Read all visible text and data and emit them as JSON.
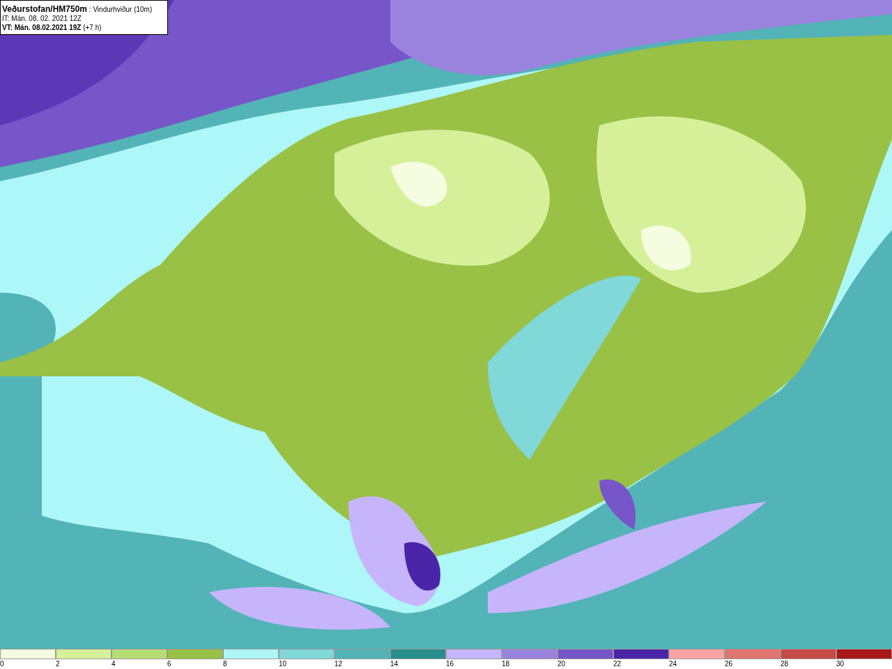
{
  "header": {
    "source": "Veðurstofan/HM750m",
    "parameter": ": Vindurhviður (10m)",
    "issue_time": "IT: Mán. 08. 02. 2021 12Z",
    "valid_time": "VT: Mán. 08.02.2021 19Z",
    "offset": "(+7 h)"
  },
  "legend": [
    {
      "label": "0",
      "color": "#f5fde0"
    },
    {
      "label": "2",
      "color": "#d6f09a"
    },
    {
      "label": "4",
      "color": "#b8dc74"
    },
    {
      "label": "6",
      "color": "#98c146"
    },
    {
      "label": "8",
      "color": "#aef7f9"
    },
    {
      "label": "10",
      "color": "#80d8d8"
    },
    {
      "label": "12",
      "color": "#52b4b6"
    },
    {
      "label": "14",
      "color": "#268e8c"
    },
    {
      "label": "16",
      "color": "#c7b5fb"
    },
    {
      "label": "18",
      "color": "#9a83dd"
    },
    {
      "label": "20",
      "color": "#7656c8"
    },
    {
      "label": "22",
      "color": "#4a25a8"
    },
    {
      "label": "24",
      "color": "#fda4a2"
    },
    {
      "label": "26",
      "color": "#e07570"
    },
    {
      "label": "28",
      "color": "#c64a46"
    },
    {
      "label": "30",
      "color": "#a81818"
    }
  ]
}
